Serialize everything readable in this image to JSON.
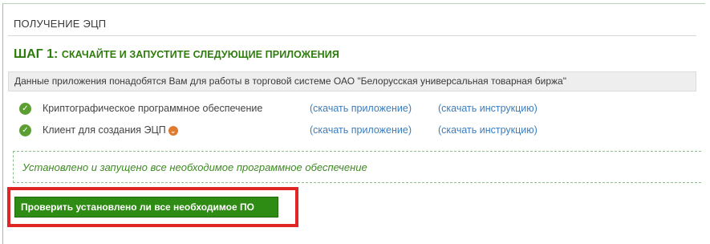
{
  "section": {
    "title": "ПОЛУЧЕНИЕ ЭЦП"
  },
  "step": {
    "number_label": "ШАГ 1:",
    "title": "СКАЧАЙТЕ И ЗАПУСТИТЕ СЛЕДУЮЩИЕ ПРИЛОЖЕНИЯ"
  },
  "info_bar": {
    "text": "Данные приложения понадобятся Вам для работы в торговой системе ОАО \"Белорусская универсальная товарная биржа\""
  },
  "apps": [
    {
      "name": "Криптографическое программное обеспечение",
      "download_app_label": "(скачать приложение)",
      "download_guide_label": "(скачать инструкцию)",
      "has_info_icon": false
    },
    {
      "name": "Клиент для создания ЭЦП",
      "download_app_label": "(скачать приложение)",
      "download_guide_label": "(скачать инструкцию)",
      "has_info_icon": true
    }
  ],
  "status": {
    "text": "Установлено и запущено все необходимое программное обеспечение"
  },
  "check_button": {
    "label": "Проверить установлено ли все необходимое ПО"
  },
  "colors": {
    "accent_green": "#2e7d0c",
    "button_green": "#2e8b13",
    "link_blue": "#3b7dbd",
    "highlight_red": "#e02525",
    "status_green": "#3f8a25",
    "info_orange": "#e07a2e"
  },
  "icons": {
    "check": "check-circle-icon",
    "info": "info-circle-icon"
  }
}
